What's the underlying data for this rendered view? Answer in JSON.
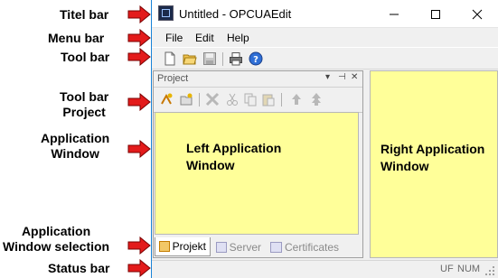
{
  "callouts": {
    "titel_bar": "Titel bar",
    "menu_bar": "Menu bar",
    "tool_bar": "Tool bar",
    "tool_bar_project_line1": "Tool bar",
    "tool_bar_project_line2": "Project",
    "app_window_line1": "Application",
    "app_window_line2": "Window",
    "app_window_selection_line1": "Application",
    "app_window_selection_line2": "Window selection",
    "status_bar": "Status bar"
  },
  "window": {
    "title": "Untitled - OPCUAEdit",
    "controls": {
      "minimize": "—",
      "maximize": "☐",
      "close": "✕"
    }
  },
  "menu": {
    "items": [
      "File",
      "Edit",
      "Help"
    ]
  },
  "toolbar": {
    "icons": [
      "new-document-icon",
      "open-folder-icon",
      "save-disk-icon",
      "print-icon",
      "help-icon"
    ]
  },
  "project_pane": {
    "title": "Project",
    "controls": {
      "dropdown": "▾",
      "pin": "⊣",
      "close": "✕"
    },
    "toolbar_icons": [
      "add-node-icon",
      "new-item-icon",
      "delete-icon",
      "cut-icon",
      "copy-icon",
      "paste-icon",
      "move-up-icon",
      "move-top-icon"
    ]
  },
  "left_app_window": {
    "line1": "Left Application",
    "line2": "Window"
  },
  "right_app_window": {
    "line1": "Right Application",
    "line2": "Window"
  },
  "tabs": [
    "Projekt",
    "Server",
    "Certificates"
  ],
  "status": {
    "ind1": "UF",
    "ind2": "NUM"
  },
  "colors": {
    "app_window_bg": "#ffff99",
    "accent": "#1883d7",
    "arrow": "#e31b1b"
  }
}
